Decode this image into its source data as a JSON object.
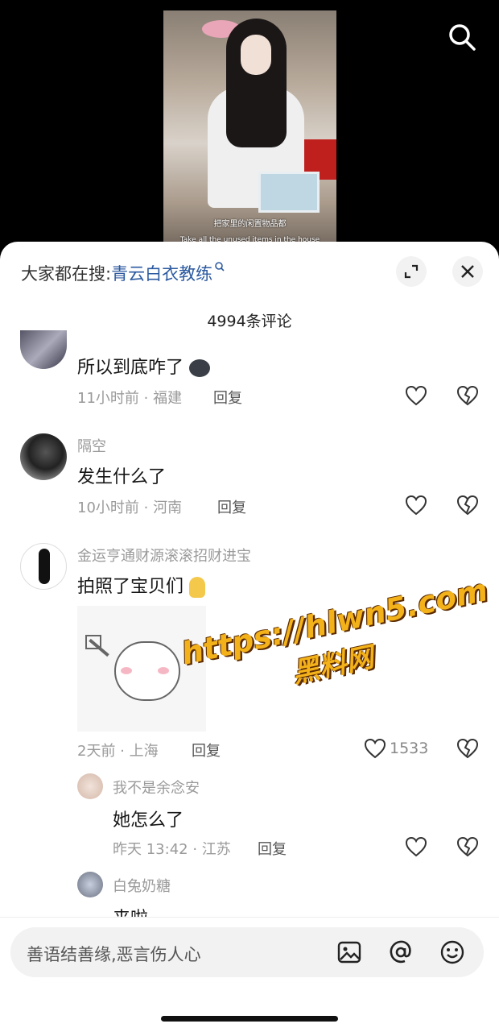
{
  "video": {
    "subtitle_cn": "把家里的闲置物品都",
    "subtitle_en": "Take all the unused items in the house"
  },
  "header": {
    "hot_prefix": "大家都在搜:",
    "hot_keyword": "青云白衣教练",
    "comment_count": "4994条评论"
  },
  "comments": [
    {
      "username": "",
      "text": "所以到底咋了",
      "time": "11小时前",
      "location": "福建",
      "reply": "回复"
    },
    {
      "username": "隔空",
      "text": "发生什么了",
      "time": "10小时前",
      "location": "河南",
      "reply": "回复"
    },
    {
      "username": "金运亨通财源滚滚招财进宝",
      "text": "拍照了宝贝们",
      "time": "2天前",
      "location": "上海",
      "reply": "回复",
      "likes": "1533"
    }
  ],
  "replies": [
    {
      "username": "我不是余念安",
      "text": "她怎么了",
      "time": "昨天 13:42",
      "location": "江苏",
      "reply": "回复"
    },
    {
      "username": "白兔奶糖",
      "text": "来啦"
    }
  ],
  "watermark": {
    "line1": "https://hlwn5.com",
    "line2": "黑料网"
  },
  "input": {
    "placeholder": "善语结善缘,恶言伤人心"
  },
  "icons": [
    "search-icon",
    "expand-icon",
    "close-icon",
    "heart-icon",
    "dislike-icon",
    "image-icon",
    "at-icon",
    "emoji-icon"
  ]
}
